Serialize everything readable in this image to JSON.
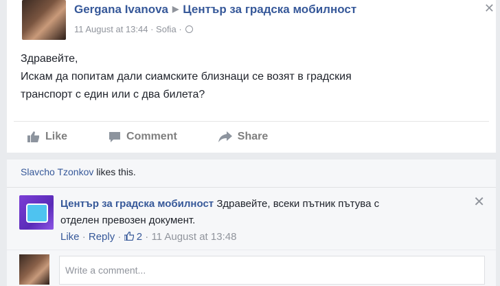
{
  "post": {
    "author": "Gergana Ivanova",
    "target": "Център за градска мобилност",
    "date": "11 August at 13:44",
    "location": "Sofia",
    "text_lines": [
      "Здравейте,",
      "Искам да попитам дали сиамските близнаци се возят в градския",
      "транспорт с един или с два билета?"
    ]
  },
  "actions": {
    "like": "Like",
    "comment": "Comment",
    "share": "Share"
  },
  "likes": {
    "name": "Slavcho Tzonkov",
    "suffix": " likes this."
  },
  "comment": {
    "author": "Център за градска мобилност",
    "text_line1": "Здравейте, всеки пътник пътува с",
    "text_line2": "отделен превозен документ.",
    "like": "Like",
    "reply": "Reply",
    "like_count": "2",
    "date": "11 August at 13:48"
  },
  "composer": {
    "placeholder": "Write a comment..."
  },
  "colors": {
    "link": "#365899",
    "muted": "#90949c",
    "background": "#e9ebee"
  }
}
